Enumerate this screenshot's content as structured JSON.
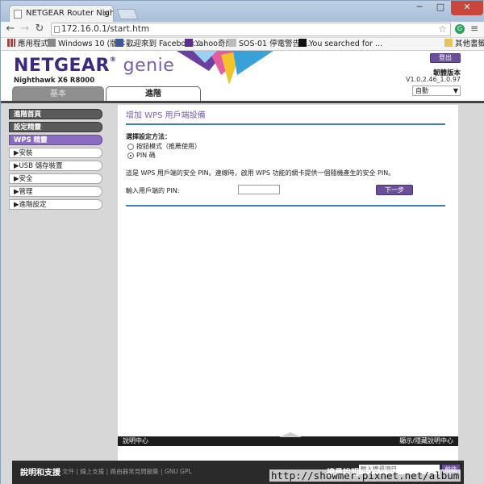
{
  "browser": {
    "tab_title": "NETGEAR Router Nighth",
    "tab_close": "×",
    "window_controls": [
      "─",
      "□",
      "✕"
    ],
    "url": "172.16.0.1/start.htm",
    "bookmarks": [
      "應用程式",
      "Windows 10 (版本 ...",
      "歡迎來到 Facebook...",
      "Yahoo奇摩",
      "SOS-01 停電警告 -...",
      "You searched for ...",
      "其他書籤"
    ]
  },
  "header": {
    "logo_main": "NETGEAR",
    "logo_sub": "genie",
    "model": "Nighthawk X6 R8000",
    "logout": "登出",
    "firmware_title": "韌體版本",
    "firmware_version": "V1.0.2.46_1.0.97",
    "language": "自動"
  },
  "tabs": {
    "basic": "基本",
    "advanced": "進階"
  },
  "sidebar": {
    "items": [
      {
        "label": "進階首頁"
      },
      {
        "label": "設定精靈"
      },
      {
        "label": "WPS 精靈"
      },
      {
        "label": "▶安裝"
      },
      {
        "label": "▶USB 儲存裝置"
      },
      {
        "label": "▶安全"
      },
      {
        "label": "▶管理"
      },
      {
        "label": "▶進階設定"
      }
    ]
  },
  "content": {
    "title": "增加 WPS 用戶端設備",
    "select_label": "選擇設定方法：",
    "option_push": "按鈕模式（推薦使用）",
    "option_pin": "PIN 碼",
    "description": "這是 WPS 用戶端的安全 PIN。連線時，啟用 WPS 功能的網卡提供一個隨機產生的安全 PIN。",
    "pin_label": "輸入用戶端的 PIN:",
    "next_button": "下一步"
  },
  "helpbar": {
    "left": "說明中心",
    "right": "顯示/隱藏說明中心"
  },
  "footer": {
    "title": "說明和支援",
    "links": "文件 | 線上支援 | 路由器常見問題集 | GNU GPL",
    "search_label": "搜尋說明",
    "search_placeholder": "輸入搜尋項目",
    "go": "前往"
  },
  "watermark": "http://showmer.pixnet.net/album",
  "colors": {
    "brand": "#3d2a7f",
    "accent": "#6c4f9a",
    "rule": "#3d7fb0"
  }
}
